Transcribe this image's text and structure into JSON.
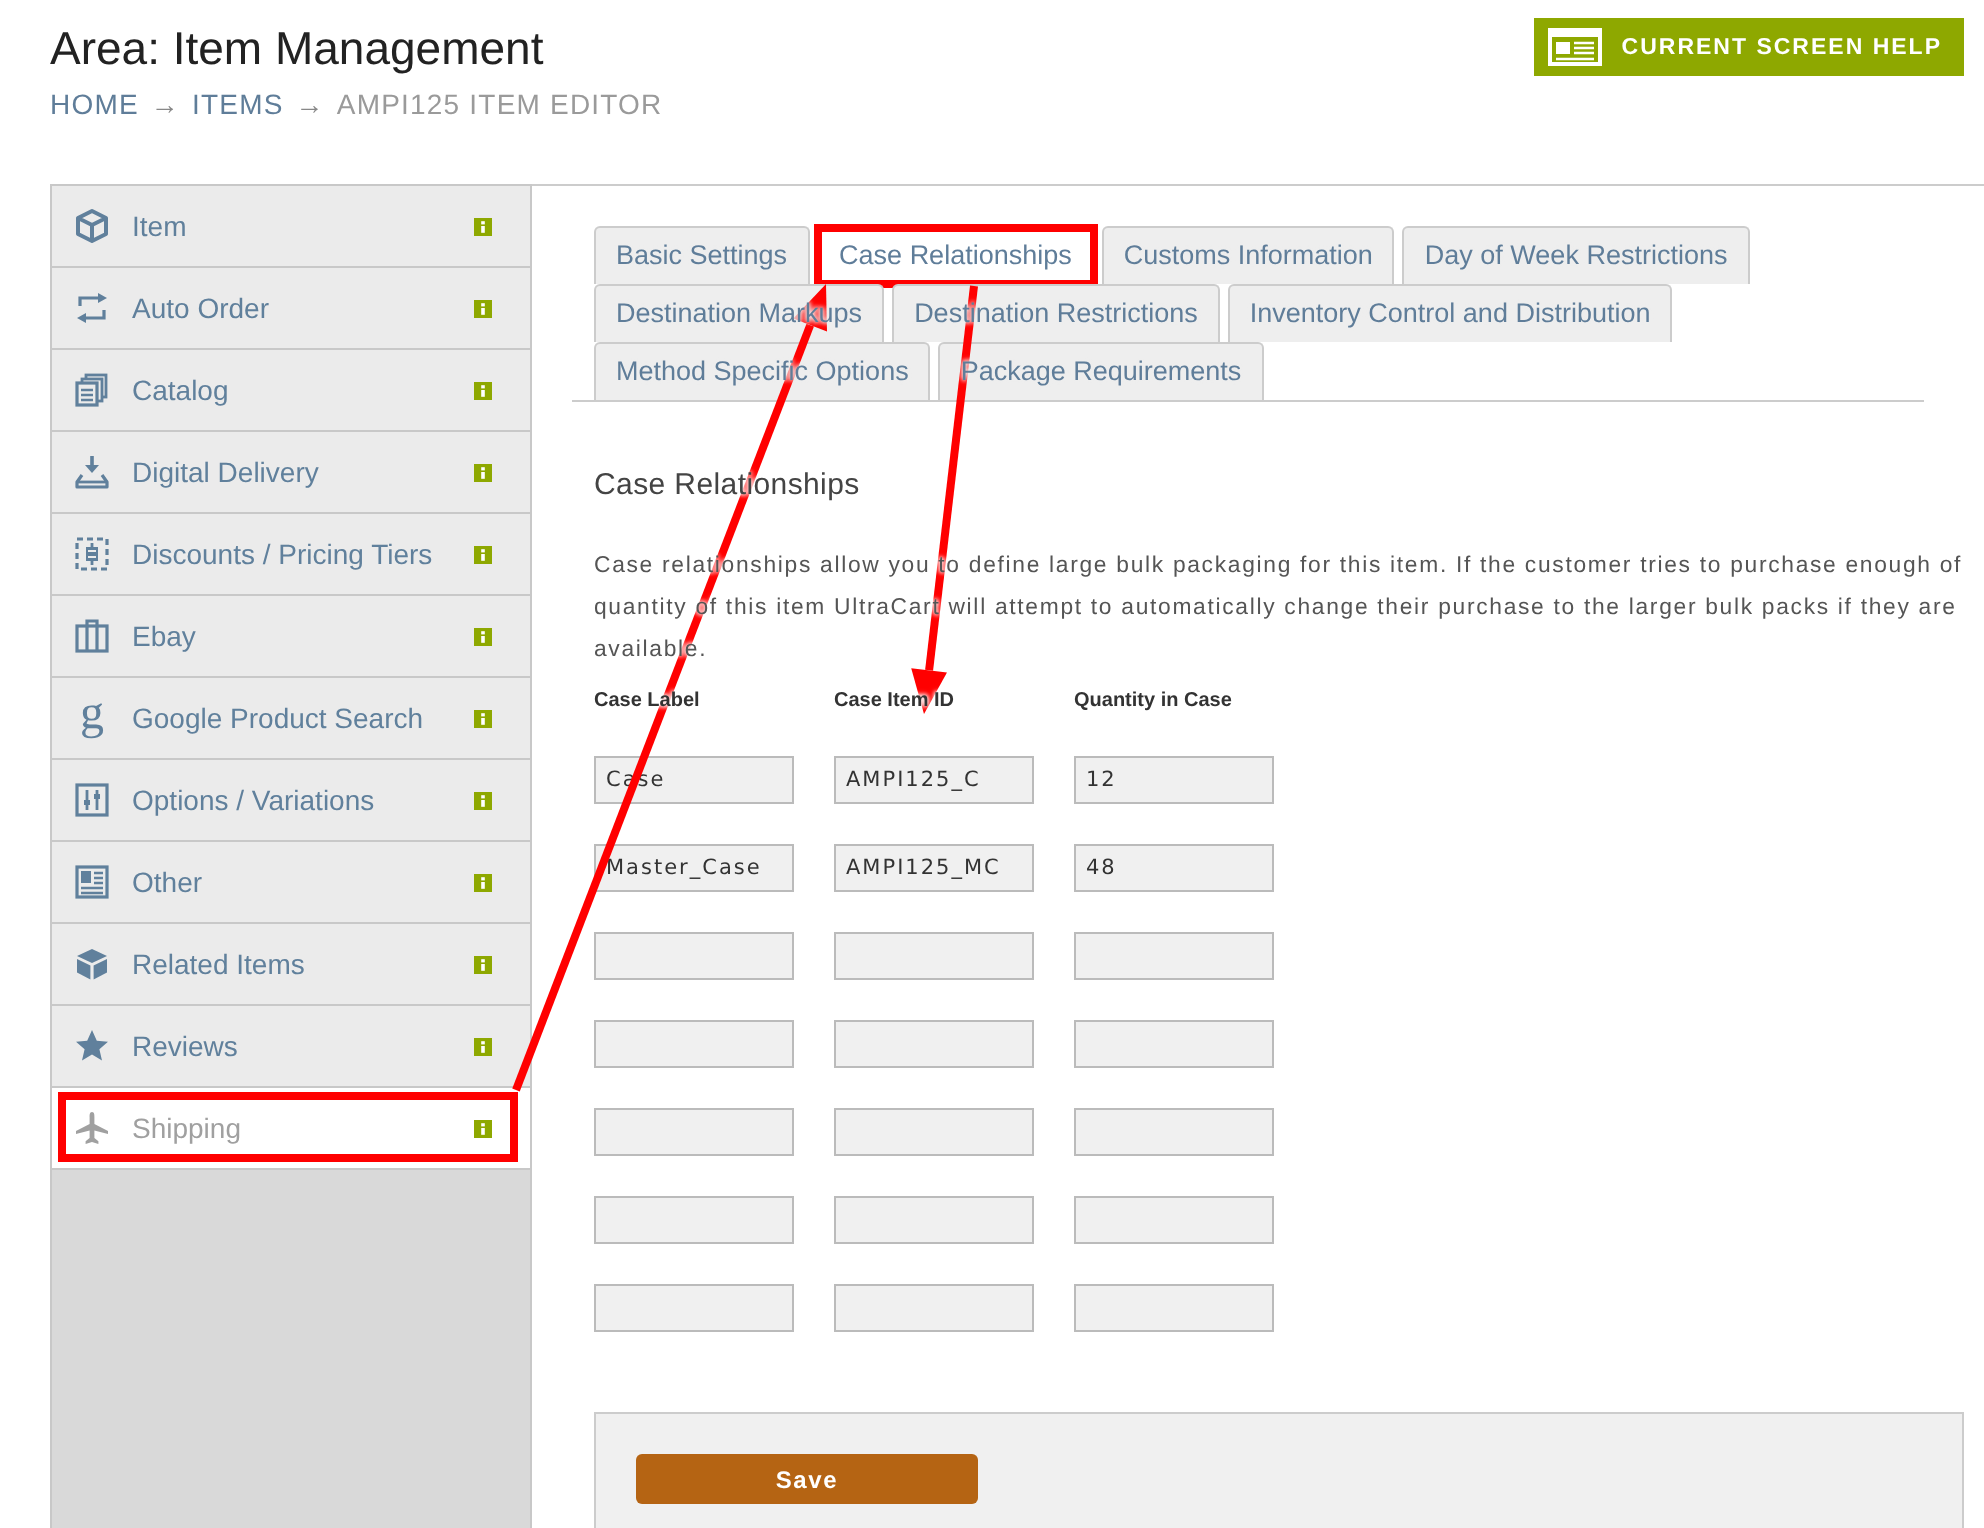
{
  "header": {
    "title": "Area: Item Management",
    "breadcrumb": [
      {
        "label": "HOME",
        "current": false
      },
      {
        "label": "ITEMS",
        "current": false
      },
      {
        "label": "AMPI125 ITEM EDITOR",
        "current": true
      }
    ],
    "breadcrumb_separators": [
      "→",
      "→"
    ],
    "help_button": "CURRENT SCREEN HELP"
  },
  "sidebar": {
    "items": [
      {
        "label": "Item",
        "selected": false,
        "highlighted": false
      },
      {
        "label": "Auto Order",
        "selected": false,
        "highlighted": false
      },
      {
        "label": "Catalog",
        "selected": false,
        "highlighted": false
      },
      {
        "label": "Digital Delivery",
        "selected": false,
        "highlighted": false
      },
      {
        "label": "Discounts / Pricing Tiers",
        "selected": false,
        "highlighted": false
      },
      {
        "label": "Ebay",
        "selected": false,
        "highlighted": false
      },
      {
        "label": "Google Product Search",
        "glyph": "g",
        "selected": false,
        "highlighted": false
      },
      {
        "label": "Options / Variations",
        "selected": false,
        "highlighted": false
      },
      {
        "label": "Other",
        "selected": false,
        "highlighted": false
      },
      {
        "label": "Related Items",
        "selected": false,
        "highlighted": false
      },
      {
        "label": "Reviews",
        "selected": false,
        "highlighted": false
      },
      {
        "label": "Shipping",
        "selected": true,
        "highlighted": true
      }
    ]
  },
  "tabs": [
    {
      "label": "Basic Settings",
      "selected": false,
      "highlighted": false
    },
    {
      "label": "Case Relationships",
      "selected": true,
      "highlighted": true
    },
    {
      "label": "Customs Information",
      "selected": false,
      "highlighted": false
    },
    {
      "label": "Day of Week Restrictions",
      "selected": false,
      "highlighted": false
    },
    {
      "label": "Destination Markups",
      "selected": false,
      "highlighted": false
    },
    {
      "label": "Destination Restrictions",
      "selected": false,
      "highlighted": false
    },
    {
      "label": "Inventory Control and Distribution",
      "selected": false,
      "highlighted": false
    },
    {
      "label": "Method Specific Options",
      "selected": false,
      "highlighted": false
    },
    {
      "label": "Package Requirements",
      "selected": false,
      "highlighted": false
    }
  ],
  "section": {
    "heading": "Case Relationships",
    "description": "Case relationships allow you to define large bulk packaging for this item. If the customer tries to purchase enough of quantity of this item UltraCart will attempt to automatically change their purchase to the larger bulk packs if they are available."
  },
  "case_table": {
    "columns": [
      "Case Label",
      "Case Item ID",
      "Quantity in Case"
    ],
    "rows": [
      {
        "case_label": "Case",
        "case_item_id": "AMPI125_C",
        "quantity_in_case": "12"
      },
      {
        "case_label": "Master_Case",
        "case_item_id": "AMPI125_MC",
        "quantity_in_case": "48"
      },
      {},
      {},
      {},
      {},
      {}
    ]
  },
  "save_button": "Save",
  "annotations": [
    {
      "kind": "arrow"
    },
    {
      "kind": "arrow"
    }
  ]
}
